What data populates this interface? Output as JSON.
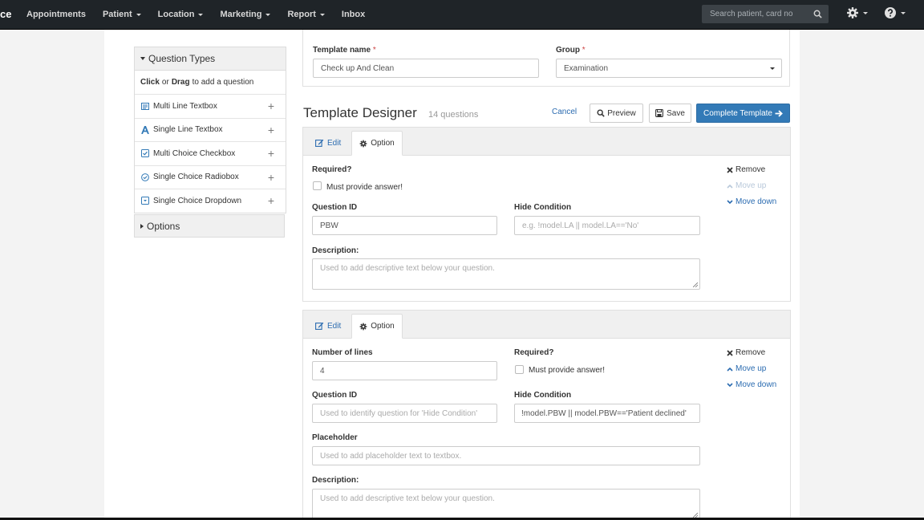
{
  "navbar": {
    "brand": "ce",
    "items": [
      {
        "label": "Appointments",
        "dropdown": false
      },
      {
        "label": "Patient",
        "dropdown": true
      },
      {
        "label": "Location",
        "dropdown": true
      },
      {
        "label": "Marketing",
        "dropdown": true
      },
      {
        "label": "Report",
        "dropdown": true
      },
      {
        "label": "Inbox",
        "dropdown": false
      }
    ],
    "search_placeholder": "Search patient, card no",
    "icons": [
      "search-icon",
      "gear-icon",
      "help-icon"
    ]
  },
  "sidebar": {
    "title": "Question Types",
    "hint_click": "Click",
    "hint_or": "or",
    "hint_drag": "Drag",
    "hint_rest": "to add a question",
    "items": [
      {
        "label": "Multi Line Textbox",
        "icon": "textarea-icon"
      },
      {
        "label": "Single Line Textbox",
        "icon": "font-icon"
      },
      {
        "label": "Multi Choice Checkbox",
        "icon": "checkbox-icon"
      },
      {
        "label": "Single Choice Radiobox",
        "icon": "radio-icon"
      },
      {
        "label": "Single Choice Dropdown",
        "icon": "dropdown-icon"
      }
    ],
    "options_title": "Options"
  },
  "template": {
    "name_label": "Template name",
    "name_value": "Check up And Clean",
    "group_label": "Group",
    "group_value": "Examination",
    "required_mark": "*"
  },
  "designer": {
    "title": "Template Designer",
    "count": "14 questions",
    "cancel": "Cancel",
    "preview": "Preview",
    "save": "Save",
    "complete": "Complete Template"
  },
  "questions": [
    {
      "tab_edit": "Edit",
      "tab_option": "Option",
      "required_label": "Required?",
      "must_answer": "Must provide answer!",
      "qid_label": "Question ID",
      "qid_value": "PBW",
      "hide_label": "Hide Condition",
      "hide_placeholder": "e.g. !model.LA || model.LA=='No'",
      "desc_label": "Description:",
      "desc_placeholder": "Used to add descriptive text below your question.",
      "remove": "Remove",
      "move_up": "Move up",
      "move_down": "Move down",
      "move_up_disabled": true
    },
    {
      "tab_edit": "Edit",
      "tab_option": "Option",
      "lines_label": "Number of lines",
      "lines_value": "4",
      "required_label": "Required?",
      "must_answer": "Must provide answer!",
      "qid_label": "Question ID",
      "qid_placeholder": "Used to identify question for 'Hide Condition'",
      "hide_label": "Hide Condition",
      "hide_value": "!model.PBW || model.PBW=='Patient declined'",
      "placeholder_label": "Placeholder",
      "placeholder_placeholder": "Used to add placeholder text to textbox.",
      "desc_label": "Description:",
      "desc_placeholder": "Used to add descriptive text below your question.",
      "remove": "Remove",
      "move_up": "Move up",
      "move_down": "Move down",
      "move_up_disabled": false
    }
  ],
  "colors": {
    "navbar_bg": "#1f2428",
    "primary": "#337ab7",
    "link": "#2a6bb0",
    "required": "#cc4444"
  }
}
